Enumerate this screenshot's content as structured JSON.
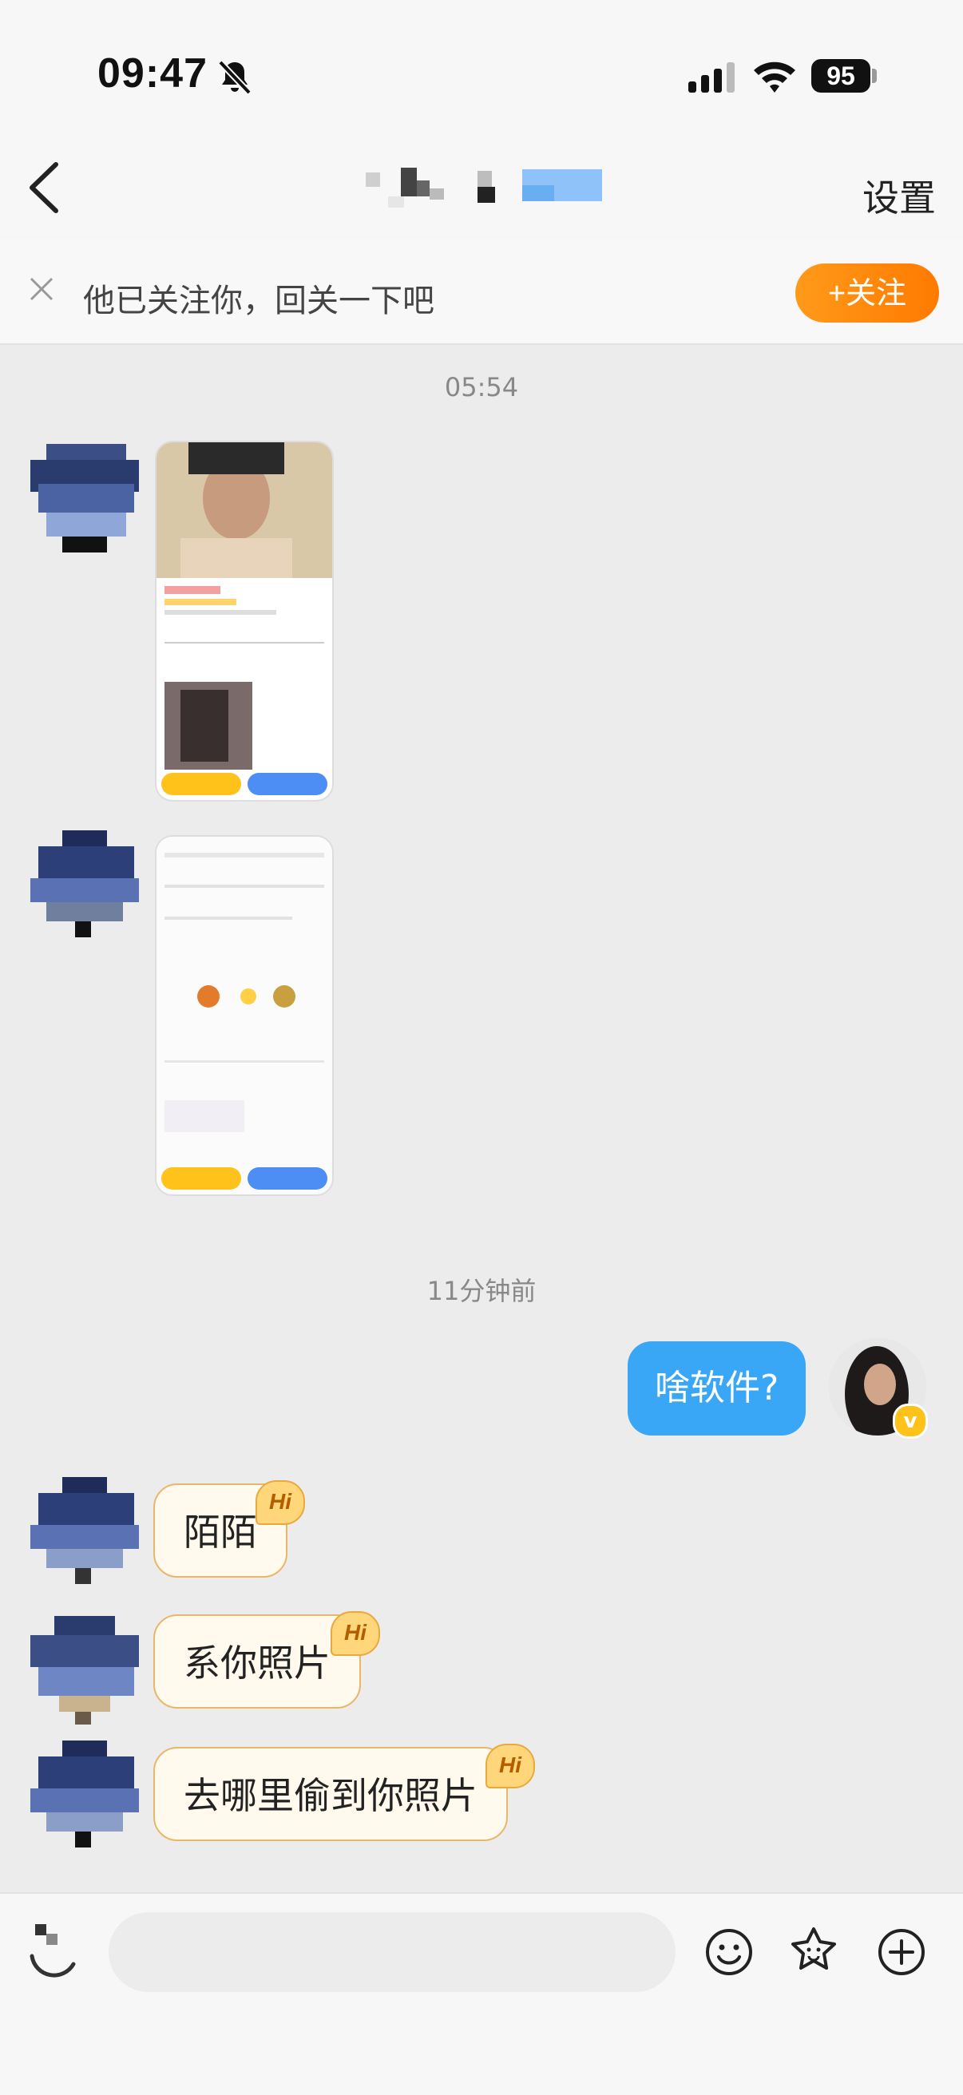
{
  "status_bar": {
    "time": "09:47",
    "battery": "95"
  },
  "header": {
    "settings_label": "设置"
  },
  "banner": {
    "text": "他已关注你，回关一下吧",
    "follow_label": "+关注"
  },
  "timestamps": {
    "first": "05:54",
    "second": "11分钟前"
  },
  "messages": {
    "me_1": "啥软件?",
    "them_1": "陌陌",
    "them_2": "系你照片",
    "them_3": "去哪里偷到你照片",
    "hi_tag": "Hi"
  },
  "icons": {
    "back": "chevron-left-icon",
    "mute": "bell-slash-icon",
    "signal": "signal-icon",
    "wifi": "wifi-icon",
    "close": "close-icon",
    "voice": "voice-icon",
    "emoji": "emoji-icon",
    "sticker": "star-sticker-icon",
    "plus": "plus-circle-icon"
  },
  "colors": {
    "accent_orange": "#ff8a00",
    "bubble_blue": "#3aa7f6",
    "hi_border": "#e9b76a"
  }
}
